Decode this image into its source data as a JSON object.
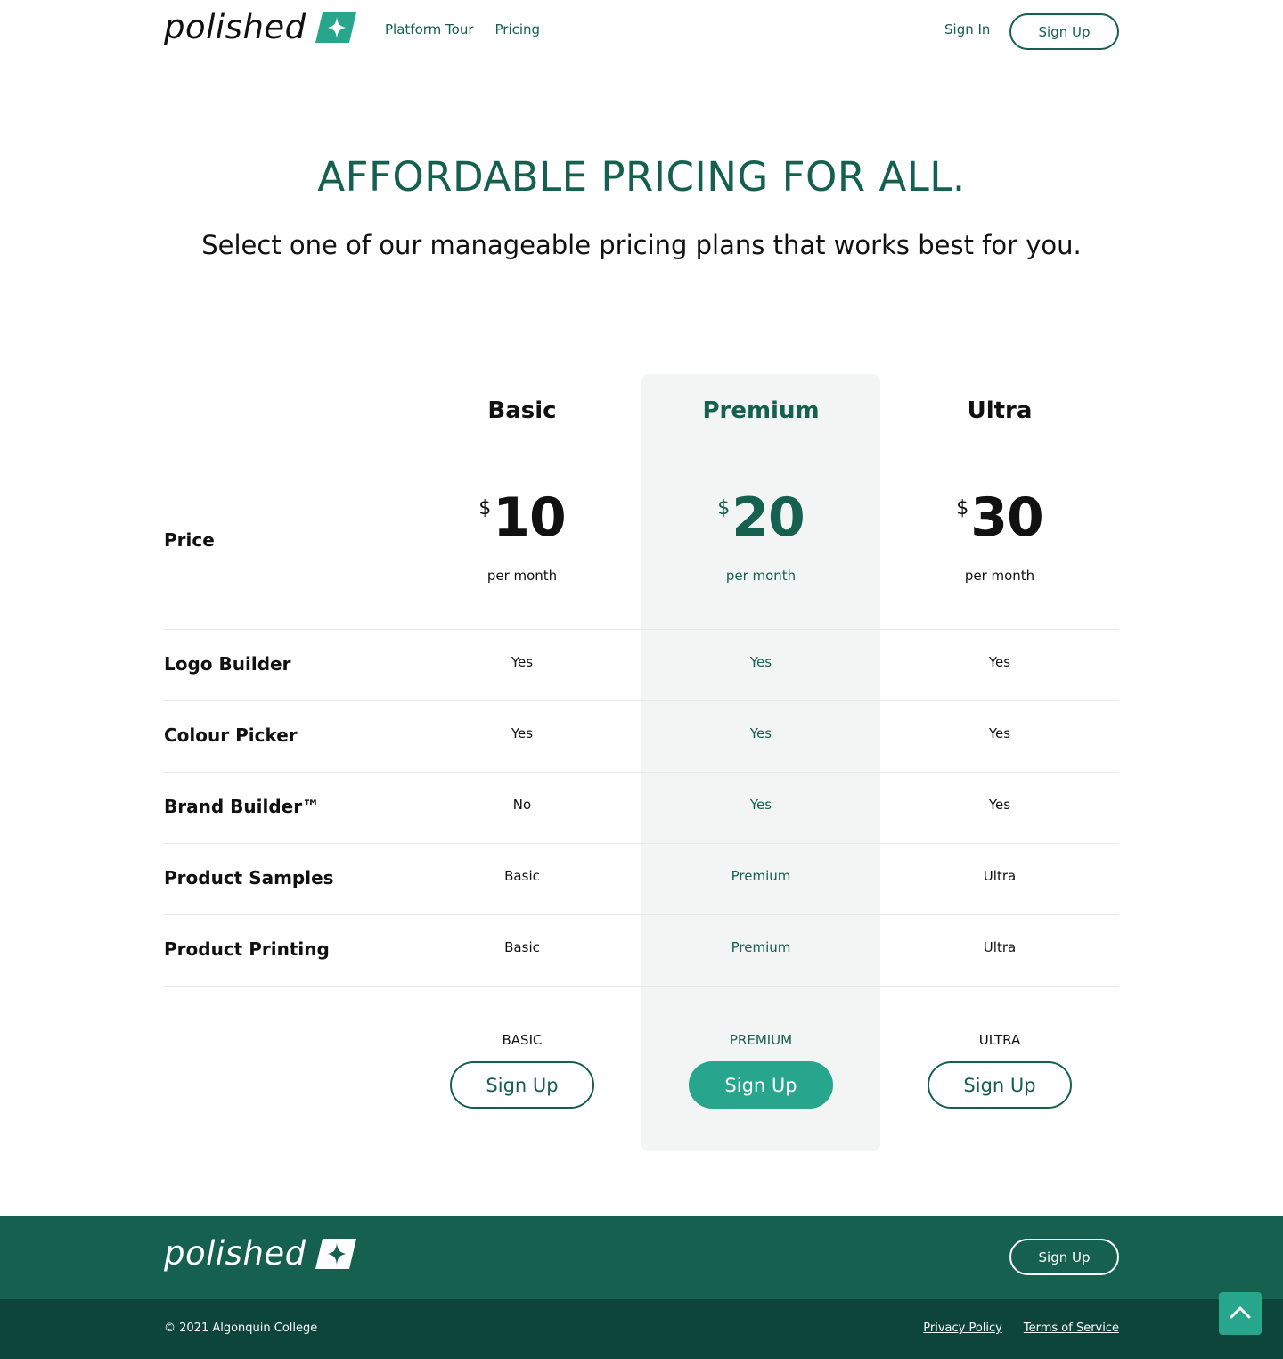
{
  "colors": {
    "brand": "#15604f",
    "accent": "#27a68d",
    "footer_dark": "#0d453a",
    "premium_bg": "#f3f5f4"
  },
  "header": {
    "logo_text": "polished",
    "logo_icon": "sparkle-icon",
    "nav": [
      "Platform Tour",
      "Pricing"
    ],
    "sign_in": "Sign In",
    "sign_up": "Sign Up"
  },
  "hero": {
    "title": "AFFORDABLE PRICING FOR ALL.",
    "subtitle": "Select one of our manageable pricing plans that works best for you."
  },
  "pricing": {
    "price_label": "Price",
    "currency": "$",
    "period": "per month",
    "plans": [
      {
        "name": "Basic",
        "price": "10",
        "caption": "BASIC",
        "button": "Sign Up"
      },
      {
        "name": "Premium",
        "price": "20",
        "caption": "PREMIUM",
        "button": "Sign Up"
      },
      {
        "name": "Ultra",
        "price": "30",
        "caption": "ULTRA",
        "button": "Sign Up"
      }
    ],
    "features": [
      {
        "label": "Logo Builder",
        "values": [
          "Yes",
          "Yes",
          "Yes"
        ]
      },
      {
        "label": "Colour Picker",
        "values": [
          "Yes",
          "Yes",
          "Yes"
        ]
      },
      {
        "label": "Brand Builder™",
        "values": [
          "No",
          "Yes",
          "Yes"
        ]
      },
      {
        "label": "Product Samples",
        "values": [
          "Basic",
          "Premium",
          "Ultra"
        ]
      },
      {
        "label": "Product Printing",
        "values": [
          "Basic",
          "Premium",
          "Ultra"
        ]
      }
    ]
  },
  "footer": {
    "logo_text": "polished",
    "sign_up": "Sign Up",
    "copyright": "© 2021 Algonquin College",
    "links": [
      "Privacy Policy",
      "Terms of Service"
    ],
    "back_to_top_icon": "chevron-up-icon"
  }
}
